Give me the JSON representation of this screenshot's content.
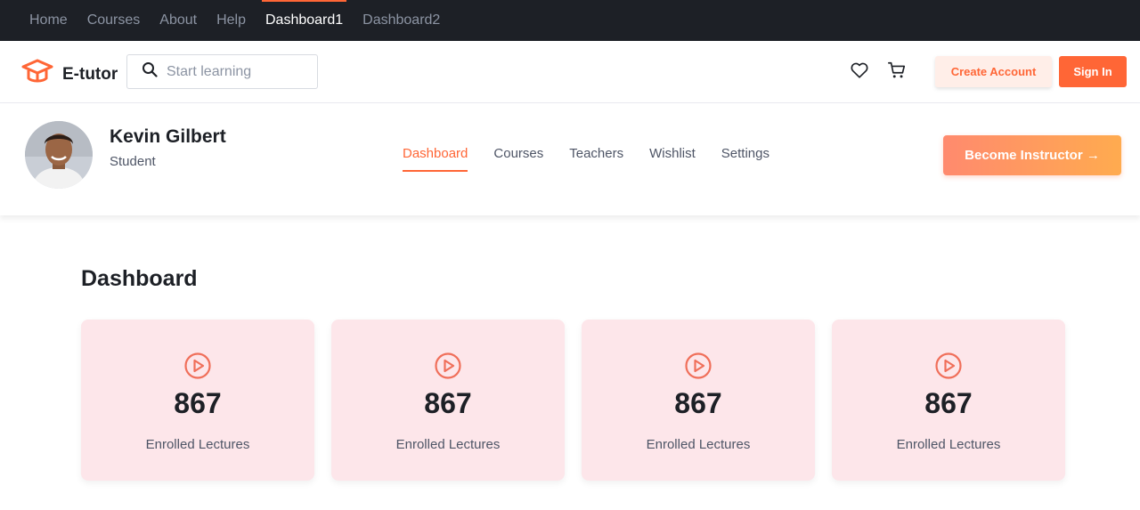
{
  "topnav": {
    "items": [
      {
        "label": "Home"
      },
      {
        "label": "Courses"
      },
      {
        "label": "About"
      },
      {
        "label": "Help"
      },
      {
        "label": "Dashboard1",
        "active": true
      },
      {
        "label": "Dashboard2"
      }
    ]
  },
  "header": {
    "logo_text": "E-tutor",
    "search_placeholder": "Start learning",
    "icons": [
      "graduation-cap-icon",
      "search-icon",
      "heart-icon",
      "cart-icon"
    ],
    "create_account_label": "Create Account",
    "sign_in_label": "Sign In"
  },
  "profile": {
    "name": "Kevin Gilbert",
    "role": "Student",
    "tabs": [
      {
        "label": "Dashboard",
        "active": true
      },
      {
        "label": "Courses"
      },
      {
        "label": "Teachers"
      },
      {
        "label": "Wishlist"
      },
      {
        "label": "Settings"
      }
    ],
    "instructor_label": "Become Instructor →"
  },
  "dashboard": {
    "title": "Dashboard",
    "cards": [
      {
        "icon": "play-circle-icon",
        "value": "867",
        "label": "Enrolled Lectures"
      },
      {
        "icon": "play-circle-icon",
        "value": "867",
        "label": "Enrolled Lectures"
      },
      {
        "icon": "play-circle-icon",
        "value": "867",
        "label": "Enrolled Lectures"
      },
      {
        "icon": "play-circle-icon",
        "value": "867",
        "label": "Enrolled Lectures"
      }
    ]
  },
  "colors": {
    "primary": "#ff6636",
    "dark": "#1d2026",
    "card_bg": "#fde6ea",
    "icon_accent": "#f06f5a"
  }
}
